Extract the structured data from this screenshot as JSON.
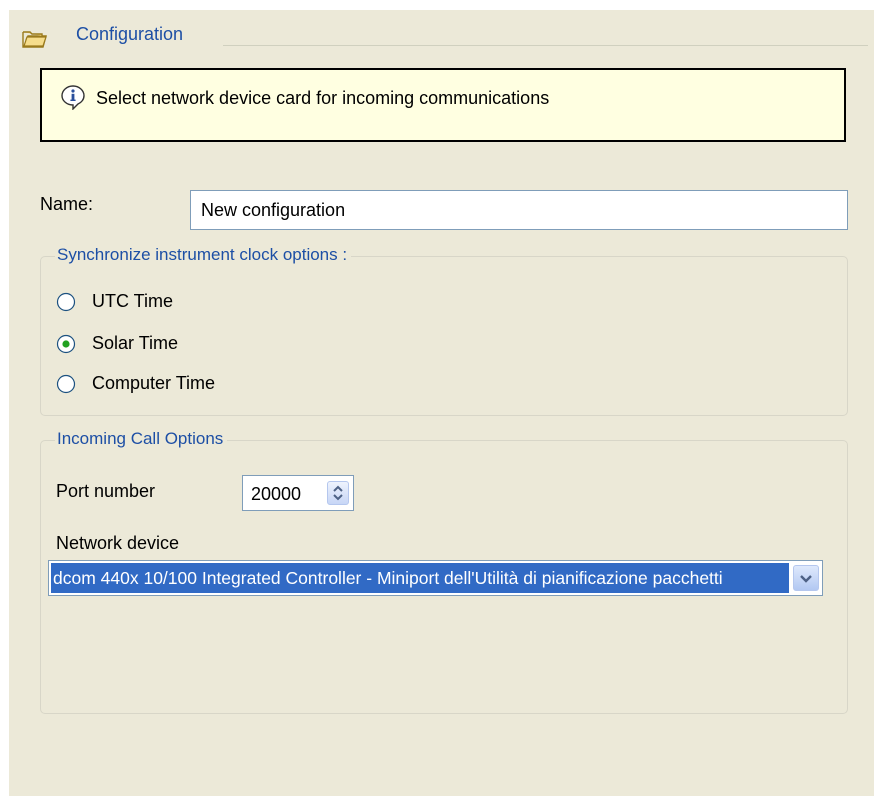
{
  "header": {
    "title": "Configuration",
    "icon": "folder-icon"
  },
  "info": {
    "text": "Select network device card for incoming communications",
    "icon": "info-icon"
  },
  "name": {
    "label": "Name:",
    "value": "New configuration"
  },
  "clock_group": {
    "legend": "Synchronize instrument clock options :",
    "options": [
      {
        "label": "UTC Time",
        "checked": false
      },
      {
        "label": "Solar Time",
        "checked": true
      },
      {
        "label": "Computer Time",
        "checked": false
      }
    ]
  },
  "incoming_group": {
    "legend": "Incoming Call Options",
    "port_label": "Port number",
    "port_value": "20000",
    "device_label": "Network device",
    "device_value": "dcom 440x 10/100 Integrated Controller - Miniport dell'Utilità di pianificazione pacchetti"
  },
  "colors": {
    "panel": "#ece9d8",
    "accent_text": "#1d4fa5",
    "selection": "#316ac5",
    "info_background": "#ffffe1"
  }
}
